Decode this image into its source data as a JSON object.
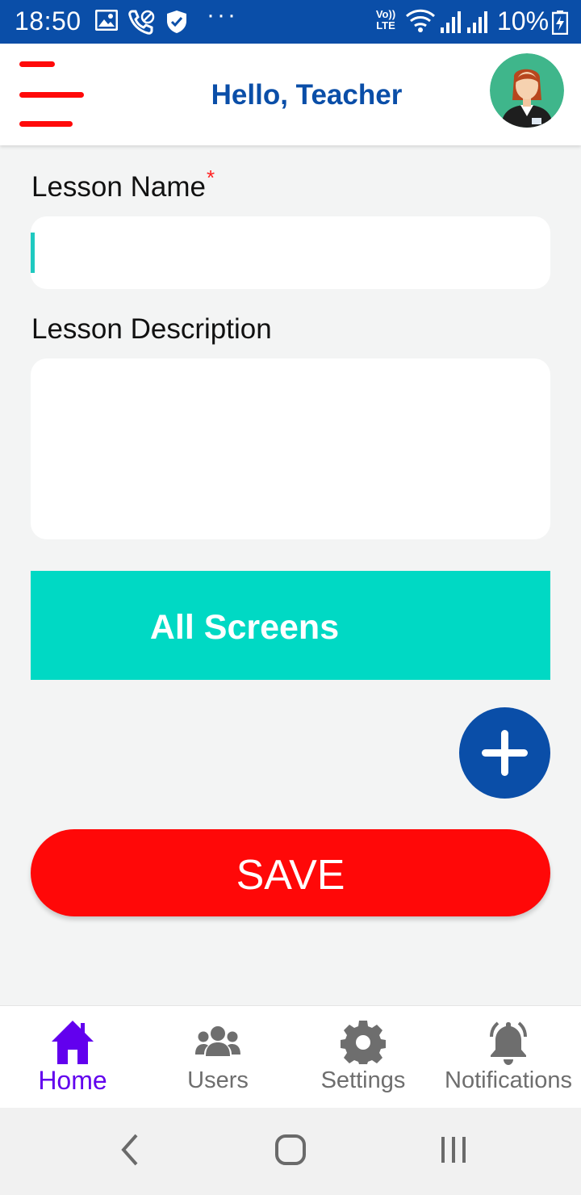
{
  "status_bar": {
    "time": "18:50",
    "network_label": "Vo)) LTE",
    "battery": "10%",
    "icons": [
      "gallery-icon",
      "wifi-call-icon",
      "shield-icon",
      "more-dots-icon",
      "wifi-icon",
      "signal-icon",
      "signal-icon",
      "battery-charging-icon"
    ]
  },
  "header": {
    "title": "Hello, Teacher",
    "menu_icon": "hamburger-menu-icon",
    "avatar_icon": "teacher-avatar-icon"
  },
  "form": {
    "lesson_name_label": "Lesson Name",
    "required_mark": "*",
    "lesson_name_value": "",
    "lesson_description_label": "Lesson Description",
    "lesson_description_value": ""
  },
  "all_screens_label": "All Screens",
  "add_button_icon": "plus-icon",
  "save_label": "SAVE",
  "bottom_nav": {
    "items": [
      {
        "label": "Home",
        "icon": "home-icon",
        "active": true
      },
      {
        "label": "Users",
        "icon": "users-icon",
        "active": false
      },
      {
        "label": "Settings",
        "icon": "gear-icon",
        "active": false
      },
      {
        "label": "Notifications",
        "icon": "bell-icon",
        "active": false
      }
    ]
  },
  "system_nav": [
    "back-icon",
    "home-circle-icon",
    "recents-icon"
  ],
  "colors": {
    "primary_blue": "#0a4ea8",
    "accent_red": "#ff0808",
    "teal": "#00d9c4",
    "active_purple": "#6200ee",
    "background": "#f3f4f4"
  }
}
